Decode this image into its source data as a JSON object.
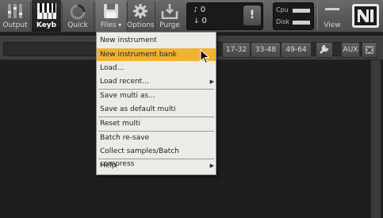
{
  "toolbar": {
    "buttons": [
      {
        "label": "Output",
        "icon": "output-meters-icon"
      },
      {
        "label": "Keyb",
        "icon": "keyboard-icon"
      },
      {
        "label": "Quick",
        "icon": "quick-load-icon"
      },
      {
        "label": "Files",
        "icon": "save-disk-icon"
      },
      {
        "label": "Options",
        "icon": "gear-icon"
      },
      {
        "label": "Purge",
        "icon": "purge-icon"
      },
      {
        "label": "View",
        "icon": "view-icon"
      }
    ],
    "midi_in": "0",
    "midi_out": "0",
    "alert": "!",
    "cpu_label": "Cpu",
    "disk_label": "Disk"
  },
  "rack": {
    "pages": [
      "17-32",
      "33-48",
      "49-64"
    ],
    "aux": "AUX"
  },
  "files_menu": {
    "items": [
      {
        "label": "New instrument"
      },
      {
        "label": "New instrument bank",
        "highlighted": true
      },
      {
        "label": "Load..."
      },
      {
        "label": "Load recent...",
        "submenu": true
      },
      {
        "label": "Save multi as..."
      },
      {
        "label": "Save as default multi"
      },
      {
        "label": "Reset multi"
      },
      {
        "label": "Batch re-save"
      },
      {
        "label": "Collect samples/Batch compress"
      },
      {
        "label": "Help",
        "submenu": true
      }
    ]
  },
  "colors": {
    "highlight": "#f0b231",
    "menu_bg": "#ecebe7",
    "toolbar": "#5a5a5a"
  }
}
